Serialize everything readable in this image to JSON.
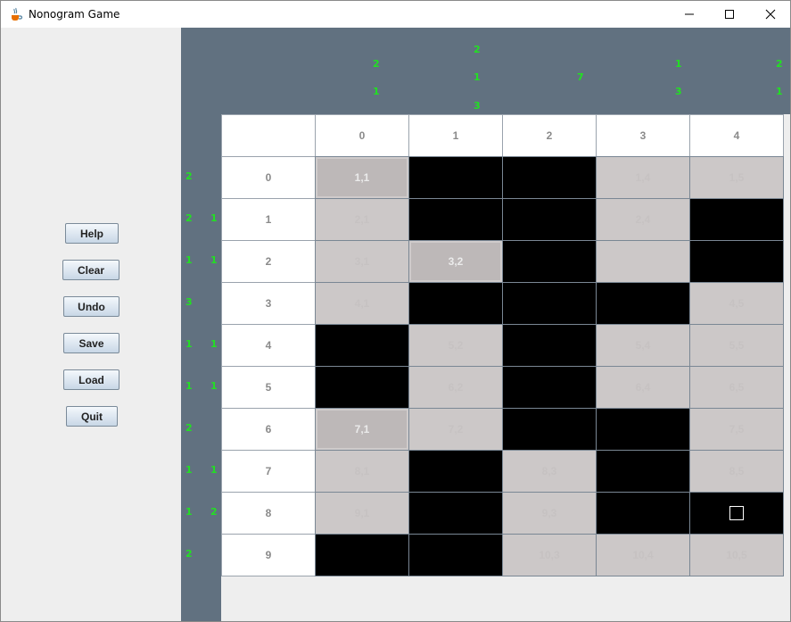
{
  "window": {
    "title": "Nonogram Game",
    "icon": "java-cup-icon",
    "controls": [
      "minimize-icon",
      "maximize-icon",
      "close-icon"
    ]
  },
  "buttons": {
    "help": "Help",
    "clear": "Clear",
    "undo": "Undo",
    "save": "Save",
    "load": "Load",
    "quit": "Quit"
  },
  "column_clues": [
    [
      "2",
      "1"
    ],
    [
      "2",
      "1",
      "3"
    ],
    [
      "7"
    ],
    [
      "1",
      "3"
    ],
    [
      "2",
      "1"
    ]
  ],
  "row_clues": [
    [
      "2"
    ],
    [
      "2",
      "1"
    ],
    [
      "1",
      "1"
    ],
    [
      "3"
    ],
    [
      "1",
      "1"
    ],
    [
      "1",
      "1"
    ],
    [
      "2"
    ],
    [
      "1",
      "1"
    ],
    [
      "1",
      "2"
    ],
    [
      "2"
    ]
  ],
  "column_headers": [
    "0",
    "1",
    "2",
    "3",
    "4"
  ],
  "row_headers": [
    "0",
    "1",
    "2",
    "3",
    "4",
    "5",
    "6",
    "7",
    "8",
    "9"
  ],
  "grid": [
    [
      "sel",
      "filled",
      "filled",
      "empty",
      "empty"
    ],
    [
      "empty",
      "filled",
      "filled",
      "empty",
      "filled"
    ],
    [
      "empty",
      "sel",
      "filled",
      "empty",
      "filled"
    ],
    [
      "empty",
      "filled",
      "filled",
      "filled",
      "empty"
    ],
    [
      "filled",
      "empty",
      "filled",
      "empty",
      "empty"
    ],
    [
      "filled",
      "empty",
      "filled",
      "empty",
      "empty"
    ],
    [
      "sel",
      "empty",
      "filled",
      "filled",
      "empty"
    ],
    [
      "empty",
      "filled",
      "empty",
      "filled",
      "empty"
    ],
    [
      "empty",
      "filled",
      "empty",
      "filled",
      "marked"
    ],
    [
      "filled",
      "filled",
      "empty",
      "empty",
      "empty"
    ]
  ],
  "cell_labels": [
    [
      "1,1",
      "",
      "",
      "1,4",
      "1,5"
    ],
    [
      "2,1",
      "",
      "",
      "2,4",
      ""
    ],
    [
      "3,1",
      "3,2",
      "",
      "",
      ""
    ],
    [
      "4,1",
      "",
      "",
      "",
      "4,5"
    ],
    [
      "",
      "5,2",
      "",
      "5,4",
      "5,5"
    ],
    [
      "",
      "6,2",
      "",
      "6,4",
      "6,5"
    ],
    [
      "7,1",
      "7,2",
      "",
      "",
      "7,5"
    ],
    [
      "8,1",
      "",
      "8,3",
      "",
      "8,5"
    ],
    [
      "9,1",
      "",
      "9,3",
      "",
      ""
    ],
    [
      "",
      "",
      "10,3",
      "10,4",
      "10,5"
    ]
  ],
  "colors": {
    "clue": "#22e022",
    "slate": "#617180",
    "filled": "#000000",
    "empty": "#ccc8c8",
    "selected": "#bdb8b8"
  }
}
